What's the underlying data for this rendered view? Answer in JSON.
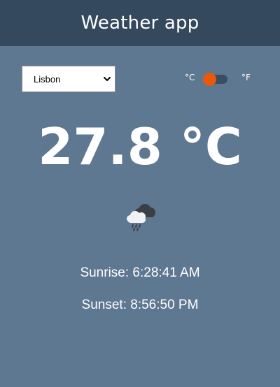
{
  "header": {
    "title": "Weather app"
  },
  "city_select": {
    "selected": "Lisbon"
  },
  "units": {
    "celsius_label": "°C",
    "fahrenheit_label": "°F",
    "selected": "celsius"
  },
  "weather": {
    "temperature": "27.8 °C",
    "condition_icon": "cloud-rain-icon",
    "sunrise": "Sunrise: 6:28:41 AM",
    "sunset": "Sunset: 8:56:50 PM"
  },
  "colors": {
    "background": "#5e7891",
    "header": "#34495e",
    "toggle_knob": "#e8590c",
    "toggle_track": "#3b4d5f"
  }
}
